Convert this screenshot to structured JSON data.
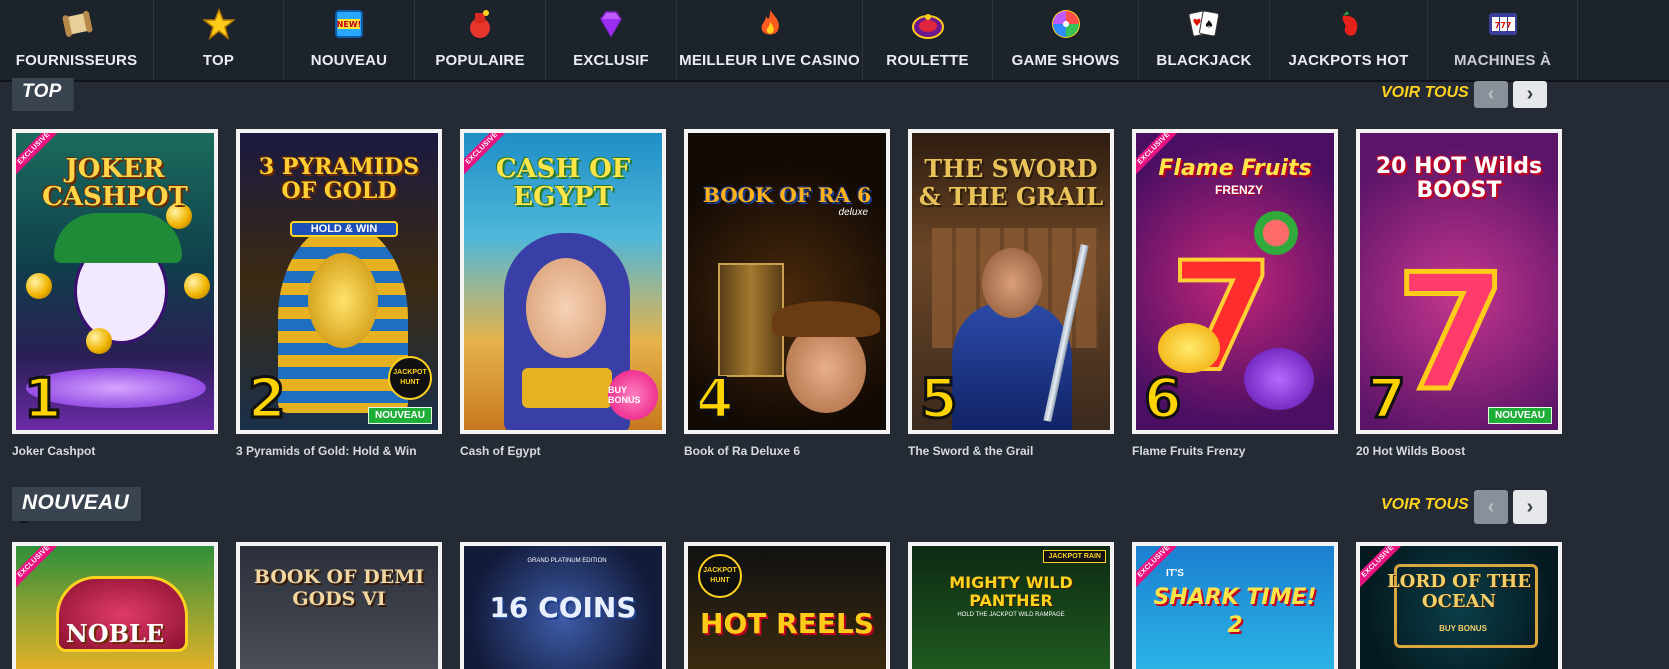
{
  "nav": {
    "items": [
      {
        "label": "FOURNISSEURS",
        "icon": "scroll-icon"
      },
      {
        "label": "TOP",
        "icon": "star-icon"
      },
      {
        "label": "NOUVEAU",
        "icon": "new-badge-icon"
      },
      {
        "label": "POPULAIRE",
        "icon": "dynamite-icon"
      },
      {
        "label": "EXCLUSIF",
        "icon": "diamond-icon"
      },
      {
        "label": "MEILLEUR LIVE CASINO",
        "icon": "fire-icon"
      },
      {
        "label": "ROULETTE",
        "icon": "roulette-icon"
      },
      {
        "label": "GAME SHOWS",
        "icon": "wheel-icon"
      },
      {
        "label": "BLACKJACK",
        "icon": "cards-icon"
      },
      {
        "label": "JACKPOTS HOT",
        "icon": "chili-icon"
      },
      {
        "label": "MACHINES À",
        "icon": "slot-icon"
      }
    ]
  },
  "sections": {
    "top": {
      "title": "TOP",
      "voir_tous": "VOIR TOUS"
    },
    "nouveau": {
      "title": "NOUVEAU",
      "voir_tous": "VOIR TOUS"
    }
  },
  "top_games": [
    {
      "name": "Joker Cashpot",
      "rank": "1",
      "logo": "JOKER CASHPOT",
      "exclusive": "EXCLUSIVE"
    },
    {
      "name": "3 Pyramids of Gold: Hold & Win",
      "rank": "2",
      "logo": "3 PYRAMIDS OF GOLD",
      "sub": "HOLD & WIN",
      "badge": "NOUVEAU",
      "seal": "JACKPOT HUNT"
    },
    {
      "name": "Cash of Egypt",
      "rank": "",
      "logo": "CASH OF EGYPT",
      "exclusive": "EXCLUSIVE",
      "seal": "BUY BONUS"
    },
    {
      "name": "Book of Ra Deluxe 6",
      "rank": "4",
      "logo": "BOOK OF RA 6",
      "sub": "deluxe"
    },
    {
      "name": "The Sword & the Grail",
      "rank": "5",
      "logo": "THE SWORD & THE GRAIL"
    },
    {
      "name": "Flame Fruits Frenzy",
      "rank": "6",
      "logo": "Flame Fruits",
      "sub": "FRENZY",
      "exclusive": "EXCLUSIVE"
    },
    {
      "name": "20 Hot Wilds Boost",
      "rank": "7",
      "logo": "20 HOT Wilds BOOST",
      "badge": "NOUVEAU"
    }
  ],
  "new_games": [
    {
      "logo": "NOBLE",
      "exclusive": "EXCLUSIVE"
    },
    {
      "logo": "BOOK OF DEMI GODS VI"
    },
    {
      "logo": "16 COINS",
      "sub": "GRAND PLATINUM EDITION"
    },
    {
      "logo": "HOT REELS",
      "seal": "JACKPOT HUNT"
    },
    {
      "logo": "MIGHTY WILD PANTHER",
      "sub": "HOLD THE JACKPOT WILD RAMPAGE",
      "seal": "JACKPOT RAIN"
    },
    {
      "logo": "SHARK TIME! 2",
      "sub": "IT'S",
      "exclusive": "EXCLUSIVE"
    },
    {
      "logo": "LORD OF THE OCEAN",
      "sub": "BUY BONUS",
      "exclusive": "EXCLUSIVE"
    }
  ],
  "colors": {
    "background": "#242b34",
    "nav_bg": "#1d232b",
    "accent_yellow": "#ffd21f",
    "badge_green": "#1fae38",
    "exclusive_pink": "#e9137f"
  }
}
